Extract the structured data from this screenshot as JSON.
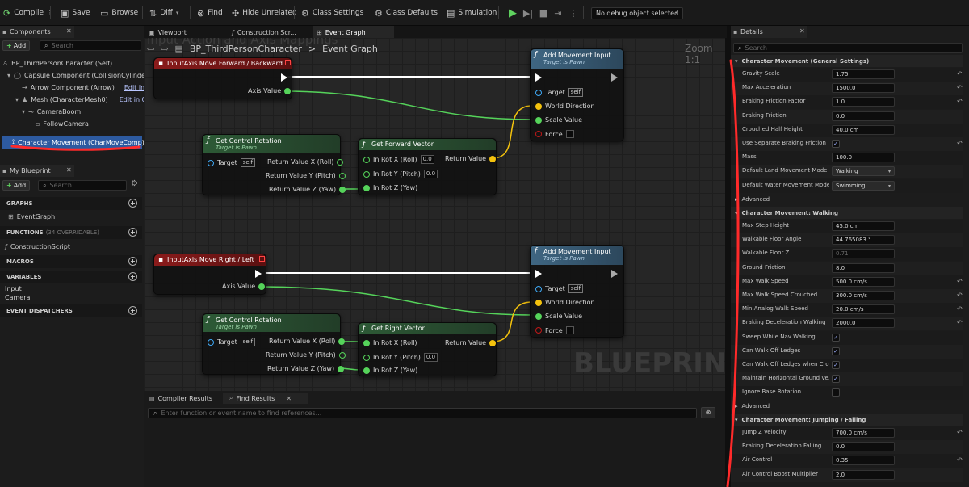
{
  "toolbar": {
    "compile": "Compile",
    "save": "Save",
    "browse": "Browse",
    "diff": "Diff",
    "find": "Find",
    "hide_unrelated": "Hide Unrelated",
    "class_settings": "Class Settings",
    "class_defaults": "Class Defaults",
    "simulation": "Simulation",
    "debug_object": "No debug object selected"
  },
  "components_panel": {
    "title": "Components",
    "add_label": "Add",
    "search_placeholder": "Search",
    "items": [
      {
        "label": "BP_ThirdPersonCharacter (Self)"
      },
      {
        "label": "Capsule Component (CollisionCylinder)"
      },
      {
        "label": "Arrow Component (Arrow)",
        "link": "Edit in C++"
      },
      {
        "label": "Mesh (CharacterMesh0)",
        "link": "Edit in C++"
      },
      {
        "label": "CameraBoom"
      },
      {
        "label": "FollowCamera"
      },
      {
        "label": "Character Movement (CharMoveComp)"
      }
    ]
  },
  "my_blueprint": {
    "title": "My Blueprint",
    "add_label": "Add",
    "search_placeholder": "Search",
    "sections": {
      "graphs": "GRAPHS",
      "event_graph": "EventGraph",
      "functions": "FUNCTIONS",
      "functions_count": "(34 OVERRIDABLE)",
      "construction_script": "ConstructionScript",
      "macros": "MACROS",
      "variables": "VARIABLES",
      "var_input": "Input",
      "var_camera": "Camera",
      "event_dispatchers": "EVENT DISPATCHERS"
    }
  },
  "editor_tabs": {
    "viewport": "Viewport",
    "construction": "Construction Scr...",
    "event_graph": "Event Graph"
  },
  "graph": {
    "breadcrumb_root": "BP_ThirdPersonCharacter",
    "breadcrumb_sep": ">",
    "breadcrumb_leaf": "Event Graph",
    "zoom": "Zoom 1:1",
    "background_title": "Input Action and Axis Mappings",
    "watermark": "BLUEPRINT",
    "nodes": {
      "axis_fwd": {
        "title": "InputAxis Move Forward / Backward",
        "axis_value": "Axis Value"
      },
      "axis_right": {
        "title": "InputAxis Move Right / Left",
        "axis_value": "Axis Value"
      },
      "get_rot_1": {
        "title": "Get Control Rotation",
        "subtitle": "Target is Pawn",
        "target": "Target",
        "self": "self",
        "rx": "Return Value X (Roll)",
        "ry": "Return Value Y (Pitch)",
        "rz": "Return Value Z (Yaw)"
      },
      "get_rot_2": {
        "title": "Get Control Rotation",
        "subtitle": "Target is Pawn",
        "target": "Target",
        "self": "self",
        "rx": "Return Value X (Roll)",
        "ry": "Return Value Y (Pitch)",
        "rz": "Return Value Z (Yaw)"
      },
      "fwd_vec": {
        "title": "Get Forward Vector",
        "ix": "In Rot X (Roll)",
        "ix_val": "0.0",
        "iy": "In Rot Y (Pitch)",
        "iy_val": "0.0",
        "iz": "In Rot Z (Yaw)",
        "ret": "Return Value"
      },
      "right_vec": {
        "title": "Get Right Vector",
        "ix": "In Rot X (Roll)",
        "iy": "In Rot Y (Pitch)",
        "iy_val": "0.0",
        "iz": "In Rot Z (Yaw)",
        "ret": "Return Value"
      },
      "add_move_1": {
        "title": "Add Movement Input",
        "subtitle": "Target is Pawn",
        "target": "Target",
        "self": "self",
        "world_dir": "World Direction",
        "scale": "Scale Value",
        "force": "Force"
      },
      "add_move_2": {
        "title": "Add Movement Input",
        "subtitle": "Target is Pawn",
        "target": "Target",
        "self": "self",
        "world_dir": "World Direction",
        "scale": "Scale Value",
        "force": "Force"
      }
    }
  },
  "bottom_panel": {
    "tab_compiler": "Compiler Results",
    "tab_find": "Find Results",
    "find_placeholder": "Enter function or event name to find references..."
  },
  "details": {
    "title": "Details",
    "search_placeholder": "Search",
    "sec_general": "Character Movement (General Settings)",
    "sec_walking": "Character Movement: Walking",
    "sec_jumping": "Character Movement: Jumping / Falling",
    "advanced": "Advanced",
    "general_rows": [
      {
        "label": "Gravity Scale",
        "value": "1.75",
        "kind": "num",
        "reset": true
      },
      {
        "label": "Max Acceleration",
        "value": "1500.0",
        "kind": "num",
        "reset": true
      },
      {
        "label": "Braking Friction Factor",
        "value": "1.0",
        "kind": "num",
        "reset": true
      },
      {
        "label": "Braking Friction",
        "value": "0.0",
        "kind": "num",
        "reset": false
      },
      {
        "label": "Crouched Half Height",
        "value": "40.0 cm",
        "kind": "num",
        "reset": false
      },
      {
        "label": "Use Separate Braking Friction",
        "value": "✓",
        "kind": "check",
        "reset": true
      },
      {
        "label": "Mass",
        "value": "100.0",
        "kind": "num",
        "reset": false
      },
      {
        "label": "Default Land Movement Mode",
        "value": "Walking",
        "kind": "dd",
        "reset": false
      },
      {
        "label": "Default Water Movement Mode",
        "value": "Swimming",
        "kind": "dd",
        "reset": false
      }
    ],
    "walking_rows": [
      {
        "label": "Max Step Height",
        "value": "45.0 cm",
        "kind": "num",
        "reset": false
      },
      {
        "label": "Walkable Floor Angle",
        "value": "44.765083 °",
        "kind": "num",
        "reset": false
      },
      {
        "label": "Walkable Floor Z",
        "value": "0.71",
        "kind": "dis",
        "reset": false
      },
      {
        "label": "Ground Friction",
        "value": "8.0",
        "kind": "num",
        "reset": false
      },
      {
        "label": "Max Walk Speed",
        "value": "500.0 cm/s",
        "kind": "num",
        "reset": true
      },
      {
        "label": "Max Walk Speed Crouched",
        "value": "300.0 cm/s",
        "kind": "num",
        "reset": true
      },
      {
        "label": "Min Analog Walk Speed",
        "value": "20.0 cm/s",
        "kind": "num",
        "reset": true
      },
      {
        "label": "Braking Deceleration Walking",
        "value": "2000.0",
        "kind": "num",
        "reset": true
      },
      {
        "label": "Sweep While Nav Walking",
        "value": "✓",
        "kind": "check",
        "reset": false
      },
      {
        "label": "Can Walk Off Ledges",
        "value": "✓",
        "kind": "check",
        "reset": false
      },
      {
        "label": "Can Walk Off Ledges when Cro...",
        "value": "✓",
        "kind": "check",
        "reset": false
      },
      {
        "label": "Maintain Horizontal Ground Ve...",
        "value": "✓",
        "kind": "check",
        "reset": false
      },
      {
        "label": "Ignore Base Rotation",
        "value": "",
        "kind": "check",
        "reset": false
      }
    ],
    "jumping_rows": [
      {
        "label": "Jump Z Velocity",
        "value": "700.0 cm/s",
        "kind": "num",
        "reset": true
      },
      {
        "label": "Braking Deceleration Falling",
        "value": "0.0",
        "kind": "num",
        "reset": false
      },
      {
        "label": "Air Control",
        "value": "0.35",
        "kind": "num",
        "reset": true
      },
      {
        "label": "Air Control Boost Multiplier",
        "value": "2.0",
        "kind": "num",
        "reset": false
      }
    ]
  },
  "colors": {
    "annotation_red": "#ff2a2a",
    "exec_white": "#ffffff",
    "float_green": "#55d35a",
    "vector_yellow": "#f4c20d",
    "object_blue": "#3fa9f5",
    "bool_red": "#c01818",
    "event_head": "#7a1515",
    "pure_head": "#2f5a3a",
    "call_head": "#3f5f78"
  }
}
